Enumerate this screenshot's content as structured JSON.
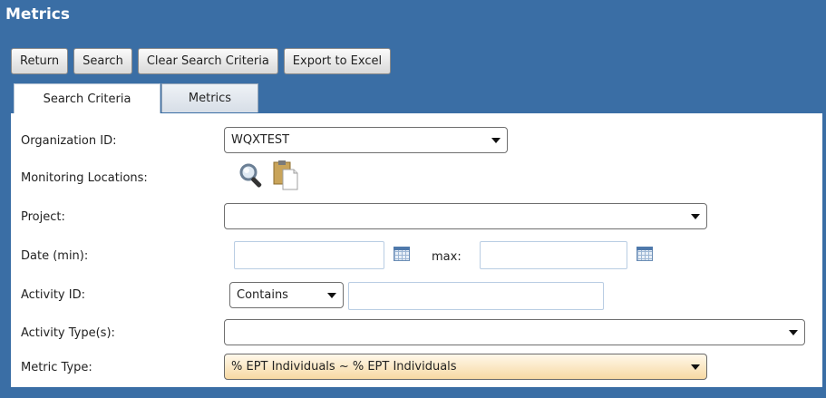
{
  "window": {
    "title": "Metrics"
  },
  "toolbar": {
    "buttons": [
      "Return",
      "Search",
      "Clear Search Criteria",
      "Export to Excel"
    ]
  },
  "tabs": [
    {
      "label": "Search Criteria",
      "active": true
    },
    {
      "label": "Metrics",
      "active": false
    }
  ],
  "form": {
    "organization_id": {
      "label": "Organization ID:",
      "value": "WQXTEST"
    },
    "monitoring_locations": {
      "label": "Monitoring Locations:",
      "icons": [
        "search-icon",
        "paste-icon"
      ]
    },
    "project": {
      "label": "Project:",
      "value": ""
    },
    "date": {
      "label": "Date (min):",
      "min_value": "",
      "max_label": "max:",
      "max_value": ""
    },
    "activity_id": {
      "label": "Activity ID:",
      "operator": "Contains",
      "value": ""
    },
    "activity_types": {
      "label": "Activity Type(s):",
      "value": ""
    },
    "metric_type": {
      "label": "Metric Type:",
      "value": "% EPT Individuals ~ % EPT Individuals"
    }
  },
  "colors": {
    "header_blue": "#3a6ea5",
    "metric_select": "#f7d9a3"
  }
}
